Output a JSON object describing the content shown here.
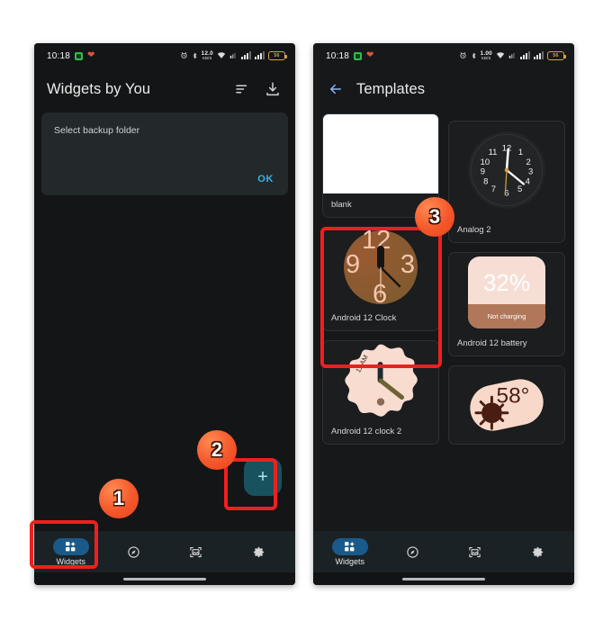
{
  "page": {
    "background": "#ffffff",
    "accent_red": "#f01f1f",
    "badge_orange": "#f4572a"
  },
  "status_bar": {
    "time": "10:18",
    "app_icon": "screen-record-icon",
    "heart_icon": "heart-icon",
    "alarm_icon": "alarm-icon",
    "bluetooth_icon": "bluetooth-icon",
    "data_rate_left": {
      "value": "12.0",
      "unit": "KB/S"
    },
    "data_rate_right": {
      "value": "1.00",
      "unit": "KB/S"
    },
    "wifi_icon": "wifi-icon",
    "mobile_data_icon": "mobile-data-icon",
    "signal_icon_1": "signal-bars-icon",
    "signal_icon_2": "signal-bars-icon",
    "battery_level": "56"
  },
  "left_phone": {
    "app_bar": {
      "title": "Widgets by You",
      "sort_icon": "sort-icon",
      "download_icon": "download-icon"
    },
    "dialog": {
      "message": "Select backup folder",
      "ok_label": "OK",
      "ok_color": "#33b5e5"
    },
    "fab": {
      "icon": "plus-icon",
      "color": "#17525e"
    }
  },
  "right_phone": {
    "app_bar": {
      "back_icon": "back-arrow-icon",
      "title": "Templates"
    },
    "templates": {
      "left_column": [
        {
          "label": "blank",
          "kind": "blank"
        },
        {
          "label": "Android 12 Clock",
          "kind": "a12clock",
          "numbers": [
            "12",
            "3",
            "6",
            "9"
          ],
          "dial_color": "#8a5a30",
          "number_color": "#f6c6ae"
        },
        {
          "label": "Android 12 clock 2",
          "kind": "scallop",
          "curved_text": "11 AM",
          "shape_color": "#f8dccf",
          "hand_color": "#6d6233"
        }
      ],
      "right_column": [
        {
          "label": "Analog 2",
          "kind": "analog",
          "numbers": [
            "12",
            "1",
            "2",
            "3",
            "4",
            "5",
            "6",
            "7",
            "8",
            "9",
            "10",
            "11"
          ],
          "dial_color": "#232425"
        },
        {
          "label": "Android 12 battery",
          "kind": "battery",
          "percent": "32%",
          "status": "Not charging",
          "bg_color": "#f7ded4",
          "fill_color": "#b0775a"
        },
        {
          "label": "",
          "kind": "weather",
          "temperature": "58°",
          "icon": "sun-icon",
          "bg_color": "#f8d9c9",
          "ink_color": "#4a1d12"
        }
      ]
    }
  },
  "bottom_nav": {
    "items": [
      {
        "label": "Widgets",
        "icon": "widgets-icon",
        "active": true
      },
      {
        "label": "",
        "icon": "compass-icon",
        "active": false
      },
      {
        "label": "",
        "icon": "image-frame-icon",
        "active": false
      },
      {
        "label": "",
        "icon": "gear-icon",
        "active": false
      }
    ],
    "active_pill_color": "#1a5a8a"
  },
  "annotations": {
    "badges": [
      {
        "number": "1",
        "target": "widgets-nav-item"
      },
      {
        "number": "2",
        "target": "add-fab"
      },
      {
        "number": "3",
        "target": "android-12-clock-template"
      }
    ],
    "highlight_color": "#f01f1f"
  }
}
